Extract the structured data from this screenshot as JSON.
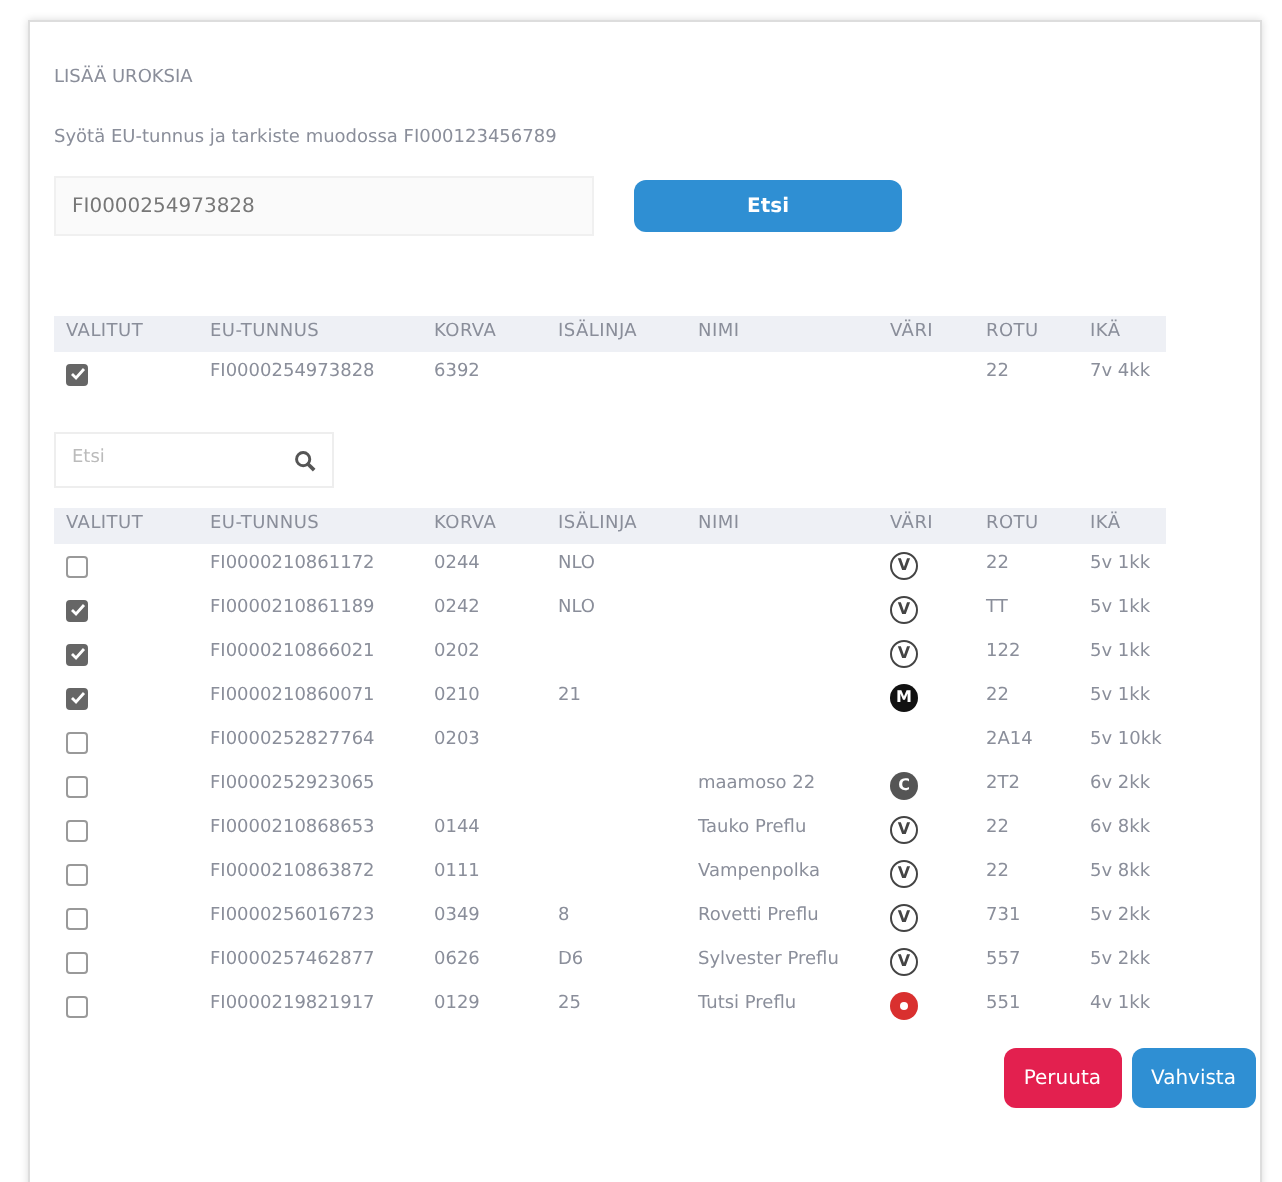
{
  "title": "LISÄÄ UROKSIA",
  "instruction": "Syötä EU-tunnus ja tarkiste muodossa FI000123456789",
  "search_input": {
    "value": "FI0000254973828"
  },
  "search_button": "Etsi",
  "found_table": {
    "columns": [
      "VALITUT",
      "EU-TUNNUS",
      "KORVA",
      "ISÄLINJA",
      "NIMI",
      "VÄRI",
      "ROTU",
      "IKÄ"
    ],
    "rows": [
      {
        "checked": true,
        "eu": "FI0000254973828",
        "korva": "6392",
        "isalinja": "",
        "nimi": "",
        "vari": null,
        "rotu": "22",
        "ika": "7v 4kk"
      }
    ]
  },
  "filter": {
    "placeholder": "Etsi"
  },
  "table": {
    "columns": [
      "VALITUT",
      "EU-TUNNUS",
      "KORVA",
      "ISÄLINJA",
      "NIMI",
      "VÄRI",
      "ROTU",
      "IKÄ"
    ],
    "rows": [
      {
        "checked": false,
        "eu": "FI0000210861172",
        "korva": "0244",
        "isalinja": "NLO",
        "nimi": "",
        "vari": {
          "kind": "outline",
          "letter": "V",
          "color": "#444444"
        },
        "rotu": "22",
        "ika": "5v 1kk"
      },
      {
        "checked": true,
        "eu": "FI0000210861189",
        "korva": "0242",
        "isalinja": "NLO",
        "nimi": "",
        "vari": {
          "kind": "outline",
          "letter": "V",
          "color": "#444444"
        },
        "rotu": "TT",
        "ika": "5v 1kk"
      },
      {
        "checked": true,
        "eu": "FI0000210866021",
        "korva": "0202",
        "isalinja": "",
        "nimi": "",
        "vari": {
          "kind": "outline",
          "letter": "V",
          "color": "#444444"
        },
        "rotu": "122",
        "ika": "5v 1kk"
      },
      {
        "checked": true,
        "eu": "FI0000210860071",
        "korva": "0210",
        "isalinja": "21",
        "nimi": "",
        "vari": {
          "kind": "filled",
          "letter": "M",
          "color": "#111111"
        },
        "rotu": "22",
        "ika": "5v 1kk"
      },
      {
        "checked": false,
        "eu": "FI0000252827764",
        "korva": "0203",
        "isalinja": "",
        "nimi": "",
        "vari": null,
        "rotu": "2A14",
        "ika": "5v 10kk"
      },
      {
        "checked": false,
        "eu": "FI0000252923065",
        "korva": "",
        "isalinja": "",
        "nimi": "maamoso 22",
        "vari": {
          "kind": "filled",
          "letter": "C",
          "color": "#555555"
        },
        "rotu": "2T2",
        "ika": "6v 2kk"
      },
      {
        "checked": false,
        "eu": "FI0000210868653",
        "korva": "0144",
        "isalinja": "",
        "nimi": "Tauko Preflu",
        "vari": {
          "kind": "outline",
          "letter": "V",
          "color": "#444444"
        },
        "rotu": "22",
        "ika": "6v 8kk"
      },
      {
        "checked": false,
        "eu": "FI0000210863872",
        "korva": "0111",
        "isalinja": "",
        "nimi": "Vampenpolka",
        "vari": {
          "kind": "outline",
          "letter": "V",
          "color": "#444444"
        },
        "rotu": "22",
        "ika": "5v 8kk"
      },
      {
        "checked": false,
        "eu": "FI0000256016723",
        "korva": "0349",
        "isalinja": "8",
        "nimi": "Rovetti Preflu",
        "vari": {
          "kind": "outline",
          "letter": "V",
          "color": "#444444"
        },
        "rotu": "731",
        "ika": "5v 2kk"
      },
      {
        "checked": false,
        "eu": "FI0000257462877",
        "korva": "0626",
        "isalinja": "D6",
        "nimi": "Sylvester Preflu",
        "vari": {
          "kind": "outline",
          "letter": "V",
          "color": "#444444"
        },
        "rotu": "557",
        "ika": "5v 2kk"
      },
      {
        "checked": false,
        "eu": "FI0000219821917",
        "korva": "0129",
        "isalinja": "25",
        "nimi": "Tutsi Preflu",
        "vari": {
          "kind": "dot",
          "color": "#d9302f"
        },
        "rotu": "551",
        "ika": "4v 1kk"
      }
    ]
  },
  "buttons": [
    {
      "label": "Peruuta",
      "kind": "cancel"
    },
    {
      "label": "Vahvista",
      "kind": "confirm"
    }
  ]
}
